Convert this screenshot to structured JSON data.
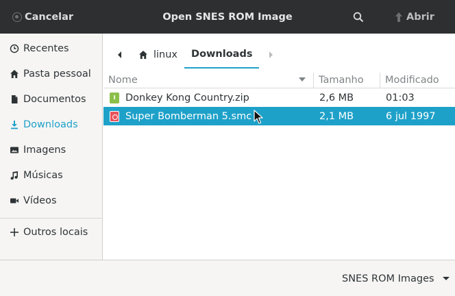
{
  "header": {
    "cancel_label": "Cancelar",
    "title": "Open SNES ROM Image",
    "open_label": "Abrir"
  },
  "sidebar": {
    "items": [
      {
        "label": "Recentes",
        "icon": "clock-icon"
      },
      {
        "label": "Pasta pessoal",
        "icon": "home-icon"
      },
      {
        "label": "Documentos",
        "icon": "document-icon"
      },
      {
        "label": "Downloads",
        "icon": "download-icon",
        "active": true
      },
      {
        "label": "Imagens",
        "icon": "image-icon"
      },
      {
        "label": "Músicas",
        "icon": "music-icon"
      },
      {
        "label": "Vídeos",
        "icon": "video-icon"
      }
    ],
    "other_locations": "Outros locais"
  },
  "pathbar": {
    "home_label": "linux",
    "current_label": "Downloads"
  },
  "filelist": {
    "columns": {
      "name": "Nome",
      "size": "Tamanho",
      "modified": "Modificado"
    },
    "rows": [
      {
        "name": "Donkey Kong Country.zip",
        "size": "2,6 MB",
        "modified": "01:03",
        "icon": "zip-archive-icon",
        "selected": false
      },
      {
        "name": "Super Bomberman 5.smc",
        "size": "2,1 MB",
        "modified": "6 jul 1997",
        "icon": "rom-file-icon",
        "selected": true
      }
    ]
  },
  "footer": {
    "filter_label": "SNES ROM Images"
  },
  "colors": {
    "accent": "#1ea1c9",
    "headerbar": "#2d2f31",
    "sidebar_bg": "#f6f5f4"
  }
}
